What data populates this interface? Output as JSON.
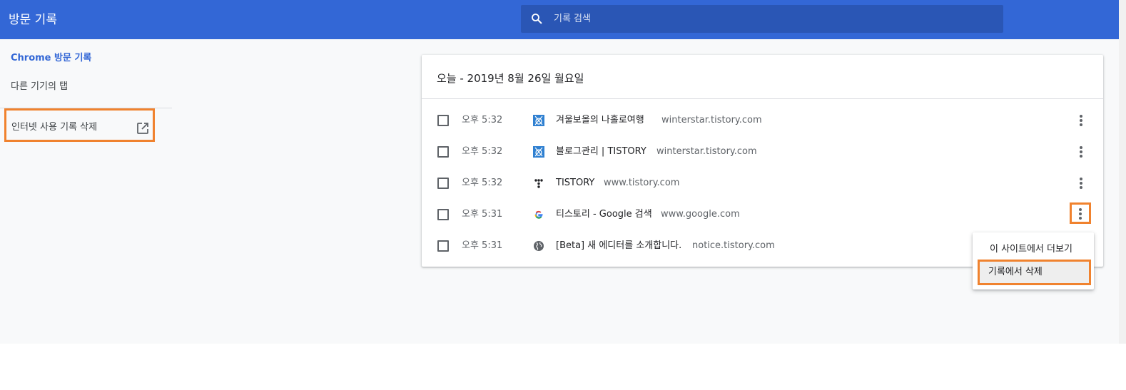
{
  "header": {
    "title": "방문 기록",
    "search_placeholder": "기록 검색",
    "icon": "search-icon"
  },
  "sidebar": {
    "chrome_history": "Chrome 방문 기록",
    "other_devices": "다른 기기의 탭",
    "clear_browsing": "인터넷 사용 기록 삭제",
    "clear_icon": "open-in-new-icon"
  },
  "main": {
    "date_heading": "오늘 - 2019년 8월 26일 월요일",
    "entries": [
      {
        "time": "오후 5:32",
        "title": "겨울보올의 나홀로여행",
        "domain": "winterstar.tistory.com",
        "favicon": "tistory-blog-favicon"
      },
      {
        "time": "오후 5:32",
        "title": "블로그관리 | TISTORY",
        "domain": "winterstar.tistory.com",
        "favicon": "tistory-blog-favicon"
      },
      {
        "time": "오후 5:32",
        "title": "TISTORY",
        "domain": "www.tistory.com",
        "favicon": "tistory-dots-favicon"
      },
      {
        "time": "오후 5:31",
        "title": "티스토리 - Google 검색",
        "domain": "www.google.com",
        "favicon": "google-favicon"
      },
      {
        "time": "오후 5:31",
        "title": "[Beta] 새 에디터를 소개합니다.",
        "domain": "notice.tistory.com",
        "favicon": "globe-favicon"
      }
    ]
  },
  "context_menu": {
    "more_from_site": "이 사이트에서 더보기",
    "remove_from_history": "기록에서 삭제"
  },
  "colors": {
    "header": "#3367d6",
    "accent": "#3367d6",
    "highlight": "#f0822e"
  }
}
